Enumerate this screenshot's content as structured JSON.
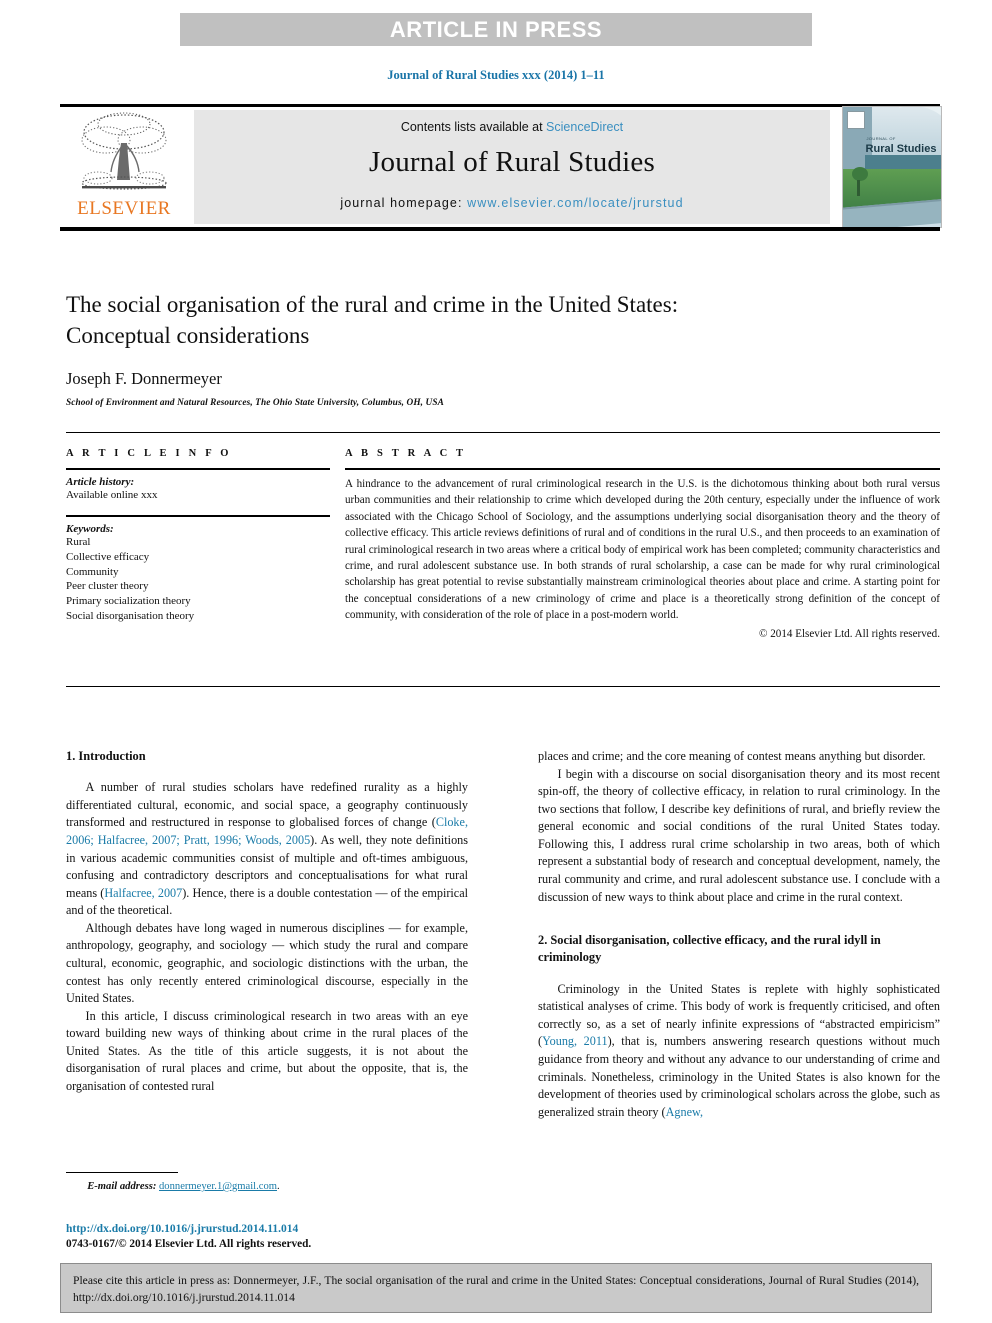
{
  "banner": {
    "text": "ARTICLE IN PRESS"
  },
  "journal_ref": "Journal of Rural Studies xxx (2014) 1–11",
  "masthead": {
    "publisher": "ELSEVIER",
    "contents_prefix": "Contents lists available at ",
    "contents_link": "ScienceDirect",
    "journal_title": "Journal of Rural Studies",
    "homepage_label": "journal homepage: ",
    "homepage_url": "www.elsevier.com/locate/jrurstud",
    "cover": {
      "kicker": "JOURNAL OF",
      "title": "Rural Studies"
    }
  },
  "article": {
    "title_line1": "The social organisation of the rural and crime in the United States:",
    "title_line2": "Conceptual considerations",
    "author": "Joseph F. Donnermeyer",
    "affiliation": "School of Environment and Natural Resources, The Ohio State University, Columbus, OH, USA"
  },
  "article_info": {
    "heading": "A R T I C L E   I N F O",
    "history_label": "Article history:",
    "history_value": "Available online xxx",
    "keywords_label": "Keywords:",
    "keywords": [
      "Rural",
      "Collective efficacy",
      "Community",
      "Peer cluster theory",
      "Primary socialization theory",
      "Social disorganisation theory"
    ]
  },
  "abstract": {
    "heading": "A B S T R A C T",
    "body": "A hindrance to the advancement of rural criminological research in the U.S. is the dichotomous thinking about both rural versus urban communities and their relationship to crime which developed during the 20th century, especially under the influence of work associated with the Chicago School of Sociology, and the assumptions underlying social disorganisation theory and the theory of collective efficacy. This article reviews definitions of rural and of conditions in the rural U.S., and then proceeds to an examination of rural criminological research in two areas where a critical body of empirical work has been completed; community characteristics and crime, and rural adolescent substance use. In both strands of rural scholarship, a case can be made for why rural criminological scholarship has great potential to revise substantially mainstream criminological theories about place and crime. A starting point for the conceptual considerations of a new criminology of crime and place is a theoretically strong definition of the concept of community, with consideration of the role of place in a post-modern world.",
    "copyright": "© 2014 Elsevier Ltd. All rights reserved."
  },
  "body": {
    "section1_heading": "1. Introduction",
    "p1_a": "A number of rural studies scholars have redefined rurality as a highly differentiated cultural, economic, and social space, a geography continuously transformed and restructured in response to globalised forces of change (",
    "p1_ref1": "Cloke, 2006; Halfacree, 2007; Pratt, 1996; Woods, 2005",
    "p1_b": "). As well, they note definitions in various academic communities consist of multiple and oft-times ambiguous, confusing and contradictory descriptors and conceptualisations for what rural means (",
    "p1_ref2": "Halfacree, 2007",
    "p1_c": "). Hence, there is a double contestation — of the empirical and of the theoretical.",
    "p2": "Although debates have long waged in numerous disciplines — for example, anthropology, geography, and sociology — which study the rural and compare cultural, economic, geographic, and sociologic distinctions with the urban, the contest has only recently entered criminological discourse, especially in the United States.",
    "p3": "In this article, I discuss criminological research in two areas with an eye toward building new ways of thinking about crime in the rural places of the United States. As the title of this article suggests, it is not about the disorganisation of rural places and crime, but about the opposite, that is, the organisation of contested rural",
    "p3_cont": "places and crime; and the core meaning of contest means anything but disorder.",
    "p4": "I begin with a discourse on social disorganisation theory and its most recent spin-off, the theory of collective efficacy, in relation to rural criminology. In the two sections that follow, I describe key definitions of rural, and briefly review the general economic and social conditions of the rural United States today. Following this, I address rural crime scholarship in two areas, both of which represent a substantial body of research and conceptual development, namely, the rural community and crime, and rural adolescent substance use. I conclude with a discussion of new ways to think about place and crime in the rural context.",
    "section2_heading": "2. Social disorganisation, collective efficacy, and the rural idyll in criminology",
    "p5_a": "Criminology in the United States is replete with highly sophisticated statistical analyses of crime. This body of work is frequently criticised, and often correctly so, as a set of nearly infinite expressions of “abstracted empiricism” (",
    "p5_ref1": "Young, 2011",
    "p5_b": "), that is, numbers answering research questions without much guidance from theory and without any advance to our understanding of crime and criminals. Nonetheless, criminology in the United States is also known for the development of theories used by criminological scholars across the globe, such as generalized strain theory (",
    "p5_ref2": "Agnew,"
  },
  "footnote": {
    "label": "E-mail address:",
    "email": "donnermeyer.1@gmail.com",
    "trailing": "."
  },
  "footer": {
    "doi": "http://dx.doi.org/10.1016/j.jrurstud.2014.11.014",
    "issn": "0743-0167/© 2014 Elsevier Ltd. All rights reserved."
  },
  "cite_box": {
    "text": "Please cite this article in press as: Donnermeyer, J.F., The social organisation of the rural and crime in the United States: Conceptual considerations, Journal of Rural Studies (2014), http://dx.doi.org/10.1016/j.jrurstud.2014.11.014"
  }
}
